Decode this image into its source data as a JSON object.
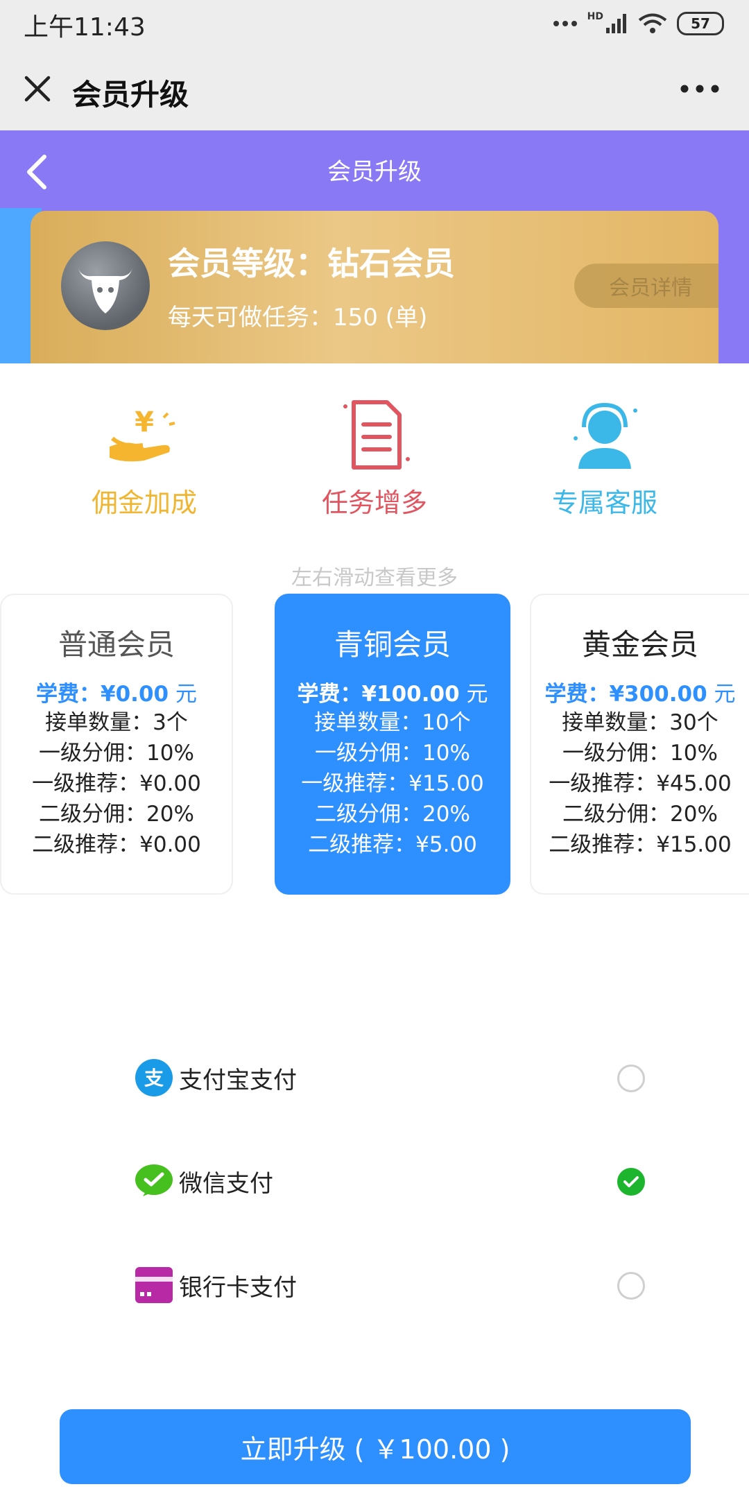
{
  "status_bar": {
    "time": "上午11:43",
    "network": "HD",
    "battery": "57"
  },
  "app_bar": {
    "title": "会员升级"
  },
  "header": {
    "title": "会员升级"
  },
  "member": {
    "level": "会员等级：钻石会员",
    "daily_tasks": "每天可做任务：150 (单)",
    "details_button": "会员详情"
  },
  "benefits": [
    {
      "label": "佣金加成",
      "color": "#f0b632"
    },
    {
      "label": "任务增多",
      "color": "#e05560"
    },
    {
      "label": "专属客服",
      "color": "#3cb8e8"
    }
  ],
  "swipe_hint": "左右滑动查看更多",
  "plans": [
    {
      "name": "普通会员",
      "fee_label": "学费：",
      "fee": "¥0.00",
      "unit": "元",
      "rows": [
        "接单数量：3个",
        "一级分佣：10%",
        "一级推荐：¥0.00",
        "二级分佣：20%",
        "二级推荐：¥0.00"
      ]
    },
    {
      "name": "青铜会员",
      "fee_label": "学费：",
      "fee": "¥100.00",
      "unit": "元",
      "rows": [
        "接单数量：10个",
        "一级分佣：10%",
        "一级推荐：¥15.00",
        "二级分佣：20%",
        "二级推荐：¥5.00"
      ]
    },
    {
      "name": "黄金会员",
      "fee_label": "学费：",
      "fee": "¥300.00",
      "unit": "元",
      "rows": [
        "接单数量：30个",
        "一级分佣：10%",
        "一级推荐：¥45.00",
        "二级分佣：20%",
        "二级推荐：¥15.00"
      ]
    }
  ],
  "payments": [
    {
      "label": "支付宝支付",
      "icon": "alipay-icon",
      "checked": false
    },
    {
      "label": "微信支付",
      "icon": "wechat-pay-icon",
      "checked": true
    },
    {
      "label": "银行卡支付",
      "icon": "bank-card-icon",
      "checked": false
    }
  ],
  "upgrade_button": "立即升级 ( ￥100.00 )",
  "colors": {
    "accent": "#2e8fff",
    "header": "#8a79f5",
    "gold": "#e3b666",
    "check": "#1db52d"
  }
}
